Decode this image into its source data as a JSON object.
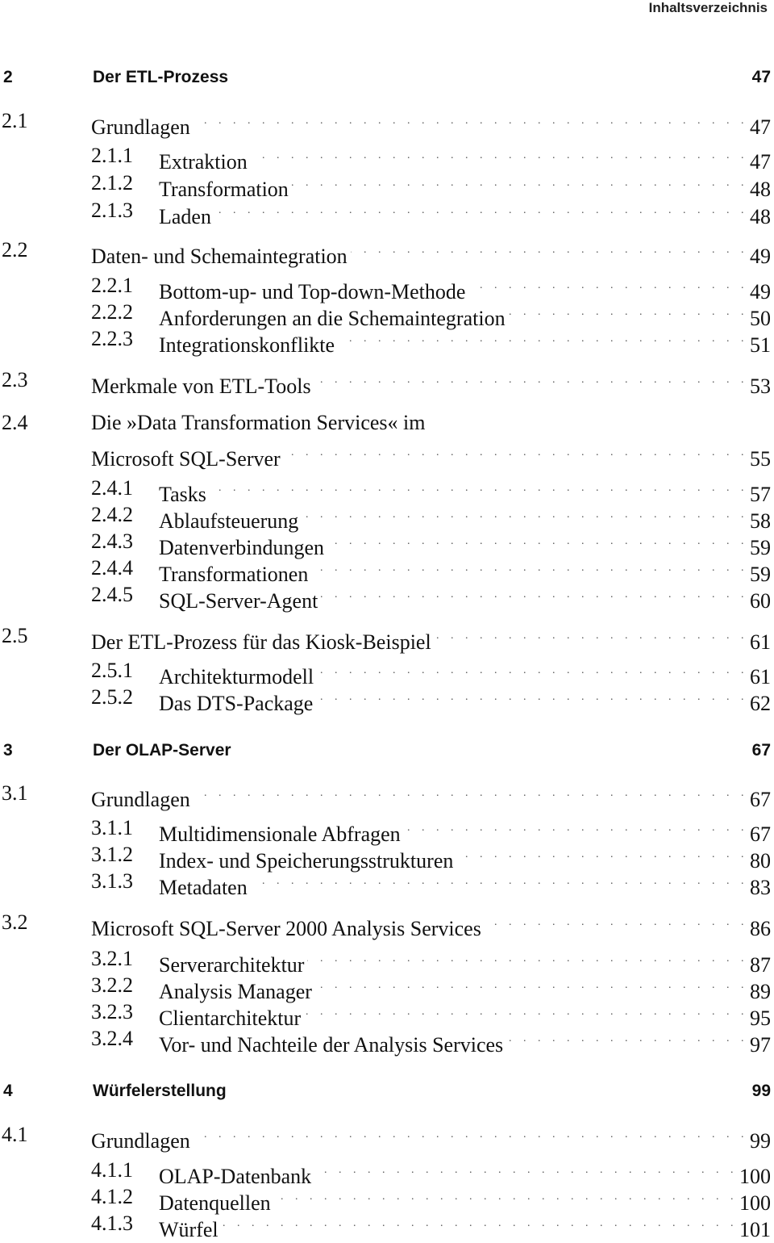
{
  "running_head": "Inhaltsverzeichnis",
  "toc": {
    "chapters": [
      {
        "number": "2",
        "title": "Der ETL-Prozess",
        "page": "47"
      },
      {
        "number": "3",
        "title": "Der OLAP-Server",
        "page": "67"
      },
      {
        "number": "4",
        "title": "Würfelerstellung",
        "page": "99"
      }
    ],
    "entries": [
      {
        "number": "2.1",
        "title": "Grundlagen",
        "page": "47"
      },
      {
        "number": "2.1.1",
        "title": "Extraktion",
        "page": "47"
      },
      {
        "number": "2.1.2",
        "title": "Transformation",
        "page": "48"
      },
      {
        "number": "2.1.3",
        "title": "Laden",
        "page": "48"
      },
      {
        "number": "2.2",
        "title": "Daten- und Schemaintegration",
        "page": "49"
      },
      {
        "number": "2.2.1",
        "title": "Bottom-up- und Top-down-Methode",
        "page": "49"
      },
      {
        "number": "2.2.2",
        "title": "Anforderungen an die Schemaintegration",
        "page": "50"
      },
      {
        "number": "2.2.3",
        "title": "Integrationskonflikte",
        "page": "51"
      },
      {
        "number": "2.3",
        "title": "Merkmale von ETL-Tools",
        "page": "53"
      },
      {
        "number": "2.4",
        "title": "Die »Data Transformation Services« im",
        "title_cont": "Microsoft SQL-Server",
        "page": "55"
      },
      {
        "number": "2.4.1",
        "title": "Tasks",
        "page": "57"
      },
      {
        "number": "2.4.2",
        "title": "Ablaufsteuerung",
        "page": "58"
      },
      {
        "number": "2.4.3",
        "title": "Datenverbindungen",
        "page": "59"
      },
      {
        "number": "2.4.4",
        "title": "Transformationen",
        "page": "59"
      },
      {
        "number": "2.4.5",
        "title": "SQL-Server-Agent",
        "page": "60"
      },
      {
        "number": "2.5",
        "title": "Der ETL-Prozess für das Kiosk-Beispiel",
        "page": "61"
      },
      {
        "number": "2.5.1",
        "title": "Architekturmodell",
        "page": "61"
      },
      {
        "number": "2.5.2",
        "title": "Das DTS-Package",
        "page": "62"
      },
      {
        "number": "3.1",
        "title": "Grundlagen",
        "page": "67"
      },
      {
        "number": "3.1.1",
        "title": "Multidimensionale Abfragen",
        "page": "67"
      },
      {
        "number": "3.1.2",
        "title": "Index- und Speicherungsstrukturen",
        "page": "80"
      },
      {
        "number": "3.1.3",
        "title": "Metadaten",
        "page": "83"
      },
      {
        "number": "3.2",
        "title": "Microsoft SQL-Server 2000 Analysis Services",
        "page": "86"
      },
      {
        "number": "3.2.1",
        "title": "Serverarchitektur",
        "page": "87"
      },
      {
        "number": "3.2.2",
        "title": "Analysis Manager",
        "page": "89"
      },
      {
        "number": "3.2.3",
        "title": "Clientarchitektur",
        "page": "95"
      },
      {
        "number": "3.2.4",
        "title": "Vor- und Nachteile der Analysis Services",
        "page": "97"
      },
      {
        "number": "4.1",
        "title": "Grundlagen",
        "page": "99"
      },
      {
        "number": "4.1.1",
        "title": "OLAP-Datenbank",
        "page": "100"
      },
      {
        "number": "4.1.2",
        "title": "Datenquellen",
        "page": "100"
      },
      {
        "number": "4.1.3",
        "title": "Würfel",
        "page": "101"
      }
    ]
  }
}
